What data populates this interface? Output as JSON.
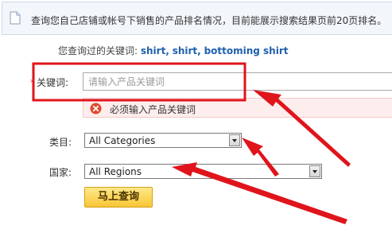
{
  "notice": {
    "icon": "document-icon",
    "text": "查询您自己店铺或帐号下销售的产品排名情况，目前能展示搜索结果页前20页排名。"
  },
  "history": {
    "label": "您查询过的关键词:",
    "keywords": [
      "shirt",
      "shirt",
      "bottoming shirt"
    ],
    "separator": ","
  },
  "keyword": {
    "required_mark": "*",
    "label": "关键词:",
    "placeholder": "请输入产品关键词",
    "value": ""
  },
  "error": {
    "icon": "error-circle-icon",
    "text": "必须输入产品关键词"
  },
  "category": {
    "label": "类目:",
    "selected": "All Categories"
  },
  "region": {
    "label": "国家:",
    "selected": "All Regions"
  },
  "submit_label": "马上查询",
  "annotations": {
    "highlight_color": "#e0141b",
    "arrow_color": "#e0141b"
  }
}
